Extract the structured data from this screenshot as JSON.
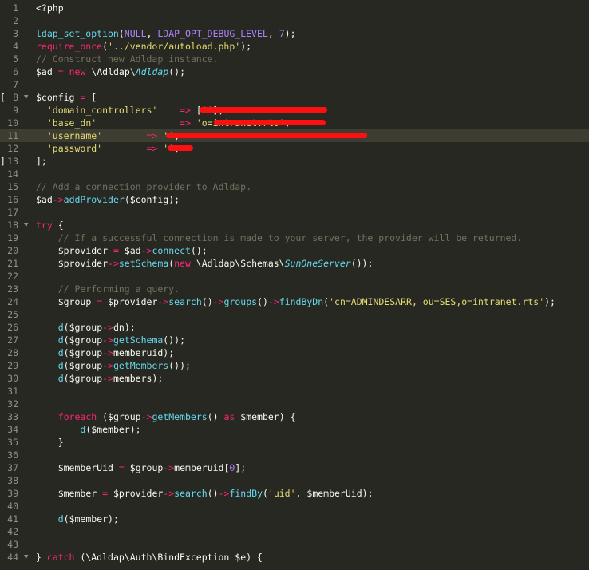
{
  "editor": {
    "language": "php",
    "active_line": "11",
    "lines": [
      {
        "n": "1",
        "text": "<?php"
      },
      {
        "n": "2",
        "text": ""
      },
      {
        "n": "3",
        "text": "ldap_set_option(NULL, LDAP_OPT_DEBUG_LEVEL, 7);"
      },
      {
        "n": "4",
        "text": "require_once('../vendor/autoload.php');"
      },
      {
        "n": "5",
        "text": "// Construct new Adldap instance."
      },
      {
        "n": "6",
        "text": "$ad = new \\Adldap\\Adldap();"
      },
      {
        "n": "7",
        "text": ""
      },
      {
        "n": "8",
        "text": "$config = ["
      },
      {
        "n": "9",
        "text": "'domain_controllers'    => [''],"
      },
      {
        "n": "10",
        "text": "'base_dn'               => 'o=intranet.rts',"
      },
      {
        "n": "11",
        "text": "'username'        => '',"
      },
      {
        "n": "12",
        "text": "'password'        => '',"
      },
      {
        "n": "13",
        "text": "];"
      },
      {
        "n": "14",
        "text": ""
      },
      {
        "n": "15",
        "text": "// Add a connection provider to Adldap."
      },
      {
        "n": "16",
        "text": "$ad->addProvider($config);"
      },
      {
        "n": "17",
        "text": ""
      },
      {
        "n": "18",
        "text": "try {"
      },
      {
        "n": "19",
        "text": "// If a successful connection is made to your server, the provider will be returned."
      },
      {
        "n": "20",
        "text": "$provider = $ad->connect();"
      },
      {
        "n": "21",
        "text": "$provider->setSchema(new \\Adldap\\Schemas\\SunOneServer());"
      },
      {
        "n": "22",
        "text": ""
      },
      {
        "n": "23",
        "text": "// Performing a query."
      },
      {
        "n": "24",
        "text": "$group = $provider->search()->groups()->findByDn('cn=ADMINDESARR, ou=SES,o=intranet.rts');"
      },
      {
        "n": "25",
        "text": ""
      },
      {
        "n": "26",
        "text": "d($group->dn);"
      },
      {
        "n": "27",
        "text": "d($group->getSchema());"
      },
      {
        "n": "28",
        "text": "d($group->memberuid);"
      },
      {
        "n": "29",
        "text": "d($group->getMembers());"
      },
      {
        "n": "30",
        "text": "d($group->members);"
      },
      {
        "n": "31",
        "text": ""
      },
      {
        "n": "32",
        "text": ""
      },
      {
        "n": "33",
        "text": "foreach ($group->getMembers() as $member) {"
      },
      {
        "n": "34",
        "text": "d($member);"
      },
      {
        "n": "35",
        "text": "}"
      },
      {
        "n": "36",
        "text": ""
      },
      {
        "n": "37",
        "text": "$memberUid = $group->memberuid[0];"
      },
      {
        "n": "38",
        "text": ""
      },
      {
        "n": "39",
        "text": "$member = $provider->search()->findBy('uid', $memberUid);"
      },
      {
        "n": "40",
        "text": ""
      },
      {
        "n": "41",
        "text": "d($member);"
      },
      {
        "n": "42",
        "text": ""
      },
      {
        "n": "43",
        "text": ""
      },
      {
        "n": "44",
        "text": "} catch (\\Adldap\\Auth\\BindException $e) {"
      }
    ]
  },
  "colors": {
    "background": "#272822",
    "keyword": "#f92672",
    "function": "#66d9ef",
    "string": "#e6db74",
    "number": "#ae81ff",
    "comment": "#75715e",
    "redaction": "#ff1010"
  }
}
